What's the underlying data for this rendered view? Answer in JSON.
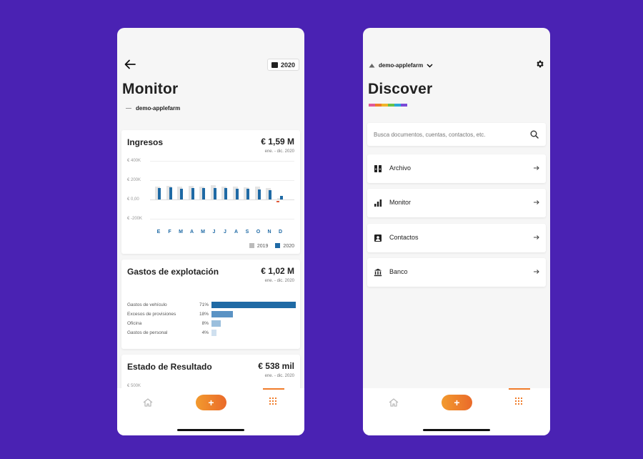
{
  "monitor": {
    "year": "2020",
    "title": "Monitor",
    "org": "demo-applefarm",
    "ingresos": {
      "title": "Ingresos",
      "value": "€ 1,59 M",
      "period": "ene. - dic. 2020",
      "yticks": [
        "€ 400K",
        "€ 200K",
        "€ 0,00",
        "€ -200K"
      ],
      "legend": [
        "2019",
        "2020"
      ]
    },
    "gastos": {
      "title": "Gastos de explotación",
      "value": "€ 1,02 M",
      "period": "ene. - dic. 2020",
      "rows": [
        {
          "label": "Gastos de vehículo",
          "pct": "71%",
          "value": 71,
          "color": "#1f6aa5"
        },
        {
          "label": "Excesos de provisiones",
          "pct": "18%",
          "value": 18,
          "color": "#5b93c4"
        },
        {
          "label": "Oficina",
          "pct": "8%",
          "value": 8,
          "color": "#9bbfdd"
        },
        {
          "label": "Gastos de personal",
          "pct": "4%",
          "value": 4,
          "color": "#cfe0ef"
        }
      ]
    },
    "resultado": {
      "title": "Estado de Resultado",
      "value": "€ 538 mil",
      "period": "ene. - dic. 2020",
      "ytick": "€ 500K"
    }
  },
  "chart_data": {
    "type": "bar",
    "categories": [
      "E",
      "F",
      "M",
      "A",
      "M",
      "J",
      "J",
      "A",
      "S",
      "O",
      "N",
      "D"
    ],
    "ylim": [
      -200000,
      400000
    ],
    "series": [
      {
        "name": "2019",
        "color": "#e4e4e4",
        "values": [
          130000,
          140000,
          135000,
          140000,
          130000,
          150000,
          130000,
          130000,
          125000,
          130000,
          115000,
          15000
        ]
      },
      {
        "name": "2020",
        "color": "#1f6aa5",
        "values": [
          120000,
          125000,
          110000,
          115000,
          115000,
          120000,
          120000,
          110000,
          110000,
          105000,
          100000,
          40000
        ]
      }
    ],
    "negative_marker": {
      "category": "D",
      "value": -10000,
      "color": "#e05a3a"
    }
  },
  "discover": {
    "org": "demo-applefarm",
    "title": "Discover",
    "rainbow": [
      "#e05a9a",
      "#f07c2a",
      "#f0b42a",
      "#6ac24a",
      "#2aa8d8",
      "#7a4ad8"
    ],
    "search_placeholder": "Busca documentos, cuentas, contactos, etc.",
    "items": [
      {
        "label": "Archivo",
        "icon": "archive-icon"
      },
      {
        "label": "Monitor",
        "icon": "bar-chart-icon"
      },
      {
        "label": "Contactos",
        "icon": "contact-icon"
      },
      {
        "label": "Banco",
        "icon": "bank-icon"
      }
    ]
  },
  "nav": {
    "fab_label": "+",
    "accent": "#f07c2a"
  }
}
